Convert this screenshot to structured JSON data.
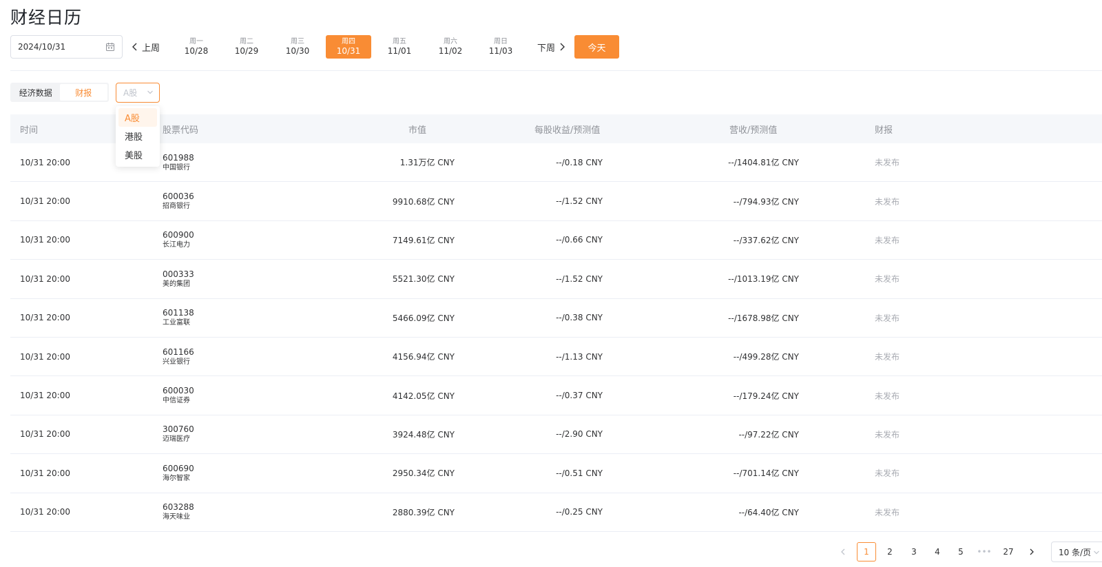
{
  "page": {
    "title": "财经日历"
  },
  "toolbar": {
    "date_value": "2024/10/31",
    "prev_week": "上周",
    "next_week": "下周",
    "today": "今天",
    "days": [
      {
        "weekday": "周一",
        "date": "10/28",
        "active": false
      },
      {
        "weekday": "周二",
        "date": "10/29",
        "active": false
      },
      {
        "weekday": "周三",
        "date": "10/30",
        "active": false
      },
      {
        "weekday": "周四",
        "date": "10/31",
        "active": true
      },
      {
        "weekday": "周五",
        "date": "11/01",
        "active": false
      },
      {
        "weekday": "周六",
        "date": "11/02",
        "active": false
      },
      {
        "weekday": "周日",
        "date": "11/03",
        "active": false
      }
    ]
  },
  "tabs": [
    {
      "label": "经济数据",
      "active": false
    },
    {
      "label": "财报",
      "active": true
    }
  ],
  "market_select": {
    "placeholder": "A股",
    "options": [
      {
        "label": "A股",
        "selected": true
      },
      {
        "label": "港股",
        "selected": false
      },
      {
        "label": "美股",
        "selected": false
      }
    ]
  },
  "table": {
    "headers": {
      "time": "时间",
      "code": "股票代码",
      "cap": "市值",
      "eps": "每股收益/预测值",
      "rev": "营收/预测值",
      "report": "财报"
    },
    "rows": [
      {
        "time": "10/31 20:00",
        "code": "601988",
        "name": "中国银行",
        "cap": "1.31万亿 CNY",
        "eps": "--/0.18 CNY",
        "rev": "--/1404.81亿 CNY",
        "status": "未发布"
      },
      {
        "time": "10/31 20:00",
        "code": "600036",
        "name": "招商银行",
        "cap": "9910.68亿 CNY",
        "eps": "--/1.52 CNY",
        "rev": "--/794.93亿 CNY",
        "status": "未发布"
      },
      {
        "time": "10/31 20:00",
        "code": "600900",
        "name": "长江电力",
        "cap": "7149.61亿 CNY",
        "eps": "--/0.66 CNY",
        "rev": "--/337.62亿 CNY",
        "status": "未发布"
      },
      {
        "time": "10/31 20:00",
        "code": "000333",
        "name": "美的集团",
        "cap": "5521.30亿 CNY",
        "eps": "--/1.52 CNY",
        "rev": "--/1013.19亿 CNY",
        "status": "未发布"
      },
      {
        "time": "10/31 20:00",
        "code": "601138",
        "name": "工业富联",
        "cap": "5466.09亿 CNY",
        "eps": "--/0.38 CNY",
        "rev": "--/1678.98亿 CNY",
        "status": "未发布"
      },
      {
        "time": "10/31 20:00",
        "code": "601166",
        "name": "兴业银行",
        "cap": "4156.94亿 CNY",
        "eps": "--/1.13 CNY",
        "rev": "--/499.28亿 CNY",
        "status": "未发布"
      },
      {
        "time": "10/31 20:00",
        "code": "600030",
        "name": "中信证券",
        "cap": "4142.05亿 CNY",
        "eps": "--/0.37 CNY",
        "rev": "--/179.24亿 CNY",
        "status": "未发布"
      },
      {
        "time": "10/31 20:00",
        "code": "300760",
        "name": "迈瑞医疗",
        "cap": "3924.48亿 CNY",
        "eps": "--/2.90 CNY",
        "rev": "--/97.22亿 CNY",
        "status": "未发布"
      },
      {
        "time": "10/31 20:00",
        "code": "600690",
        "name": "海尔智家",
        "cap": "2950.34亿 CNY",
        "eps": "--/0.51 CNY",
        "rev": "--/701.14亿 CNY",
        "status": "未发布"
      },
      {
        "time": "10/31 20:00",
        "code": "603288",
        "name": "海天味业",
        "cap": "2880.39亿 CNY",
        "eps": "--/0.25 CNY",
        "rev": "--/64.40亿 CNY",
        "status": "未发布"
      }
    ]
  },
  "pagination": {
    "pages": [
      "1",
      "2",
      "3",
      "4",
      "5"
    ],
    "ellipsis": "•••",
    "last_page": "27",
    "current": "1",
    "page_size": "10 条/页"
  },
  "colors": {
    "accent": "#f98c34",
    "header_bg": "#f5f7fa",
    "muted": "#a8abb2"
  },
  "icons": {
    "date_input": "calendar-icon",
    "prev": "chevron-left-icon",
    "next": "chevron-right-icon",
    "select": "chevron-down-icon"
  }
}
